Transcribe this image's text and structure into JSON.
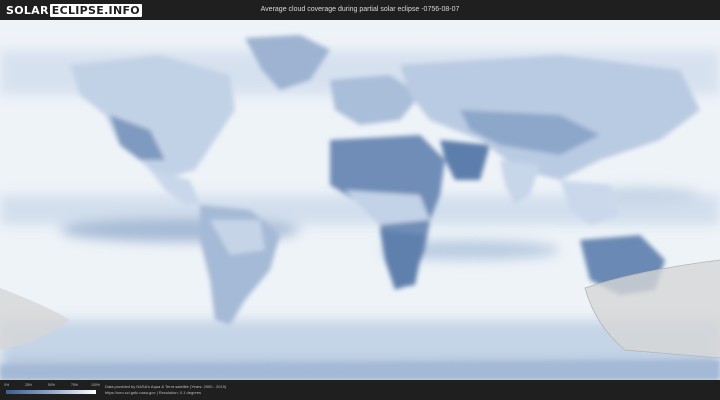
{
  "header": {
    "logo_part1": "SOLAR",
    "logo_part2": "ECLIPSE.INFO",
    "title": "Average cloud coverage during partial solar eclipse -0756-08-07"
  },
  "legend": {
    "ticks": [
      "0%",
      "25%",
      "50%",
      "75%",
      "100%"
    ]
  },
  "footer": {
    "credit_line1": "Data provided by NASA's Aqua & Terra satellite (Years: 2000 - 2019)",
    "credit_line2": "https://neo.sci.gsfc.nasa.gov | Resolution: 0.1 degrees"
  },
  "colors": {
    "ocean": "#f2f5f9",
    "cloud_light": "#d4e0ee",
    "cloud_dark": "#4a6f9e",
    "eclipse_zone": "#d9d9d9"
  }
}
